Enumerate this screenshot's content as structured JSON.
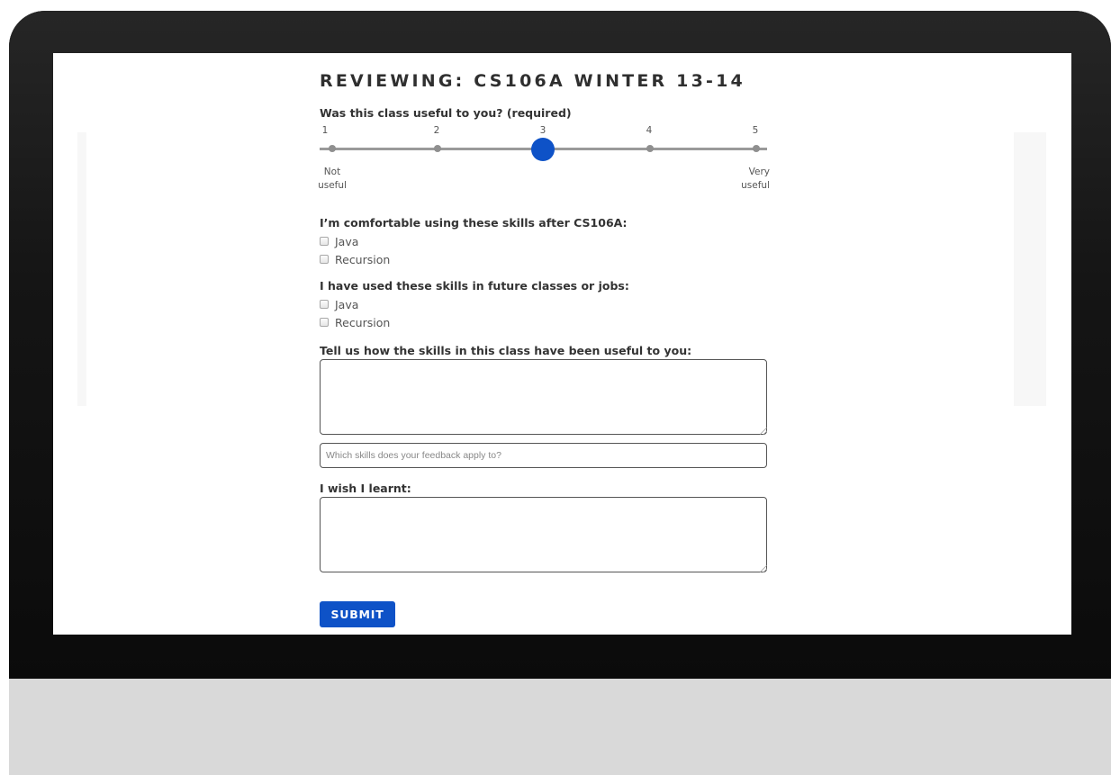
{
  "page": {
    "title": "REVIEWING: CS106A WINTER 13-14"
  },
  "usefulness": {
    "question": "Was this class useful to you? (required)",
    "scale": [
      "1",
      "2",
      "3",
      "4",
      "5"
    ],
    "selected": 3,
    "low_label": "Not useful",
    "high_label": "Very useful"
  },
  "comfortable": {
    "question": "I’m comfortable using these skills after CS106A:",
    "options": [
      {
        "label": "Java",
        "checked": false
      },
      {
        "label": "Recursion",
        "checked": false
      }
    ]
  },
  "used": {
    "question": "I have used these skills in future classes or jobs:",
    "options": [
      {
        "label": "Java",
        "checked": false
      },
      {
        "label": "Recursion",
        "checked": false
      }
    ]
  },
  "feedback": {
    "question": "Tell us how the skills in this class have been useful to you:",
    "value": "",
    "skills_placeholder": "Which skills does your feedback apply to?"
  },
  "wish": {
    "question": "I wish I learnt:",
    "value": ""
  },
  "submit_label": "SUBMIT",
  "colors": {
    "accent": "#0e52c7",
    "bezel": "#111111",
    "chin": "#d9d9d9"
  }
}
